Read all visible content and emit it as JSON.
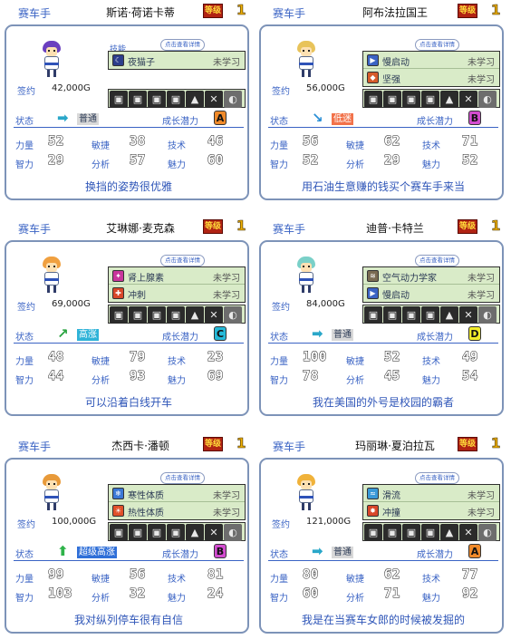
{
  "labels": {
    "role": "赛车手",
    "skills_title": "技能",
    "tip": "点击查看详情",
    "contract": "签约",
    "state": "状态",
    "growth": "成长潜力",
    "power": "力量",
    "agility": "敏捷",
    "technique": "技术",
    "intellect": "智力",
    "analysis": "分析",
    "charm": "魅力",
    "grade_badge": "等级"
  },
  "equipment_icons": [
    "▣",
    "▣",
    "▣",
    "▣",
    "▲",
    "✕",
    "◐"
  ],
  "cards": [
    {
      "name": "斯诺·荷诺卡蒂",
      "grade": "1",
      "contract": "42,000G",
      "hair_color": "#6a3fbf",
      "show_skill_title": true,
      "skills": [
        {
          "icon": "moon-icon",
          "glyph": "☾",
          "icon_bg": "#2c3e8c",
          "name": "夜猫子",
          "status": "未学习"
        }
      ],
      "state": {
        "arrow": "➡",
        "arrow_color": "#2aa7c9",
        "text": "普通",
        "bg": "#d9d9d9",
        "color": "#2b3a55"
      },
      "growth": {
        "grade": "A",
        "bg": "#f08a2a"
      },
      "stats": {
        "power": "52",
        "agility": "38",
        "technique": "46",
        "intellect": "29",
        "analysis": "57",
        "charm": "60"
      },
      "motto": "换挡的姿势很优雅"
    },
    {
      "name": "阿布法拉国王",
      "grade": "1",
      "contract": "56,000G",
      "hair_color": "#e8c35a",
      "show_skill_title": false,
      "skills": [
        {
          "icon": "start-icon",
          "glyph": "▶",
          "icon_bg": "#3b63c4",
          "name": "慢启动",
          "status": "未学习"
        },
        {
          "icon": "tough-icon",
          "glyph": "◆",
          "icon_bg": "#d65b2a",
          "name": "坚强",
          "status": "未学习"
        }
      ],
      "state": {
        "arrow": "↘",
        "arrow_color": "#2a8fd6",
        "text": "低迷",
        "bg": "#f2724a",
        "color": "#ffffff"
      },
      "growth": {
        "grade": "B",
        "bg": "#d24ccf"
      },
      "stats": {
        "power": "56",
        "agility": "62",
        "technique": "71",
        "intellect": "52",
        "analysis": "29",
        "charm": "52"
      },
      "motto": "用石油生意赚的钱买个赛车手来当"
    },
    {
      "name": "艾琳娜·麦克森",
      "grade": "1",
      "contract": "69,000G",
      "hair_color": "#f0a040",
      "show_skill_title": false,
      "skills": [
        {
          "icon": "adrenaline-icon",
          "glyph": "✦",
          "icon_bg": "#c9359c",
          "name": "肾上腺素",
          "status": "未学习"
        },
        {
          "icon": "sprint-icon",
          "glyph": "✚",
          "icon_bg": "#d8472a",
          "name": "冲刺",
          "status": "未学习"
        }
      ],
      "state": {
        "arrow": "↗",
        "arrow_color": "#27a33f",
        "text": "高涨",
        "bg": "#2fb3d8",
        "color": "#ffffff"
      },
      "growth": {
        "grade": "C",
        "bg": "#25b9d8"
      },
      "stats": {
        "power": "48",
        "agility": "79",
        "technique": "23",
        "intellect": "44",
        "analysis": "93",
        "charm": "69"
      },
      "motto": "可以沿着白线开车"
    },
    {
      "name": "迪普·卡特兰",
      "grade": "1",
      "contract": "84,000G",
      "hair_color": "#7ad0c8",
      "show_skill_title": false,
      "skills": [
        {
          "icon": "aero-icon",
          "glyph": "≋",
          "icon_bg": "#7a6b52",
          "name": "空气动力学家",
          "status": "未学习"
        },
        {
          "icon": "start-icon",
          "glyph": "▶",
          "icon_bg": "#3b63c4",
          "name": "慢启动",
          "status": "未学习"
        }
      ],
      "state": {
        "arrow": "➡",
        "arrow_color": "#2aa7c9",
        "text": "普通",
        "bg": "#d9d9d9",
        "color": "#2b3a55"
      },
      "growth": {
        "grade": "D",
        "bg": "#f2ec2a"
      },
      "stats": {
        "power": "100",
        "agility": "52",
        "technique": "49",
        "intellect": "78",
        "analysis": "45",
        "charm": "54"
      },
      "motto": "我在美国的外号是校园的霸者"
    },
    {
      "name": "杰西卡·潘顿",
      "grade": "1",
      "contract": "100,000G",
      "hair_color": "#e89a3a",
      "show_skill_title": false,
      "skills": [
        {
          "icon": "cold-icon",
          "glyph": "❄",
          "icon_bg": "#3b78d6",
          "name": "寒性体质",
          "status": "未学习"
        },
        {
          "icon": "heat-icon",
          "glyph": "☀",
          "icon_bg": "#e0502a",
          "name": "热性体质",
          "status": "未学习"
        }
      ],
      "state": {
        "arrow": "⬆",
        "arrow_color": "#2fb34a",
        "text": "超级高涨",
        "bg": "#2f6fd8",
        "color": "#ffffff"
      },
      "growth": {
        "grade": "B",
        "bg": "#d24ccf"
      },
      "stats": {
        "power": "99",
        "agility": "56",
        "technique": "81",
        "intellect": "103",
        "analysis": "32",
        "charm": "24"
      },
      "motto": "我对纵列停车很有自信"
    },
    {
      "name": "玛丽琳·夏泊拉瓦",
      "grade": "1",
      "contract": "121,000G",
      "hair_color": "#f0b23a",
      "show_skill_title": false,
      "skills": [
        {
          "icon": "slipstream-icon",
          "glyph": "≈",
          "icon_bg": "#3a9ad8",
          "name": "滑流",
          "status": "未学习"
        },
        {
          "icon": "crash-icon",
          "glyph": "✸",
          "icon_bg": "#d8472a",
          "name": "冲撞",
          "status": "未学习"
        }
      ],
      "state": {
        "arrow": "➡",
        "arrow_color": "#2aa7c9",
        "text": "普通",
        "bg": "#d9d9d9",
        "color": "#2b3a55"
      },
      "growth": {
        "grade": "A",
        "bg": "#f08a2a"
      },
      "stats": {
        "power": "80",
        "agility": "62",
        "technique": "77",
        "intellect": "60",
        "analysis": "71",
        "charm": "92"
      },
      "motto": "我是在当赛车女郎的时候被发掘的"
    }
  ]
}
